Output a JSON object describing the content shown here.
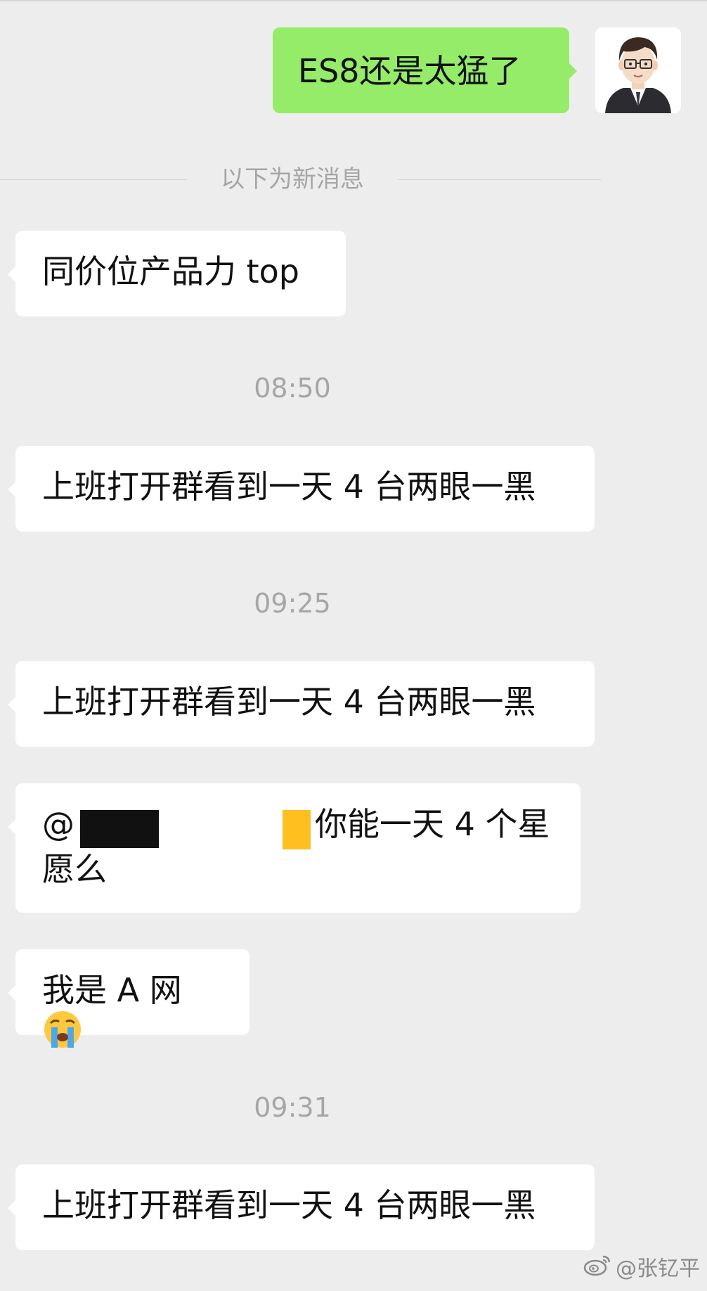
{
  "messages": {
    "outgoing_1": "ES8还是太猛了",
    "divider_label": "以下为新消息",
    "incoming_1": "同价位产品力 top",
    "time_1": "08:50",
    "incoming_2": "上班打开群看到一天 4 台两眼一黑",
    "time_2": "09:25",
    "incoming_3": "上班打开群看到一天 4 台两眼一黑",
    "incoming_4": {
      "at": "@",
      "text_line1": "你能一天 4 个星",
      "text_line2": "愿么"
    },
    "incoming_5": "我是 A 网",
    "time_3": "09:31",
    "incoming_6": "上班打开群看到一天 4 台两眼一黑"
  },
  "watermark": "@张钇平",
  "icons": {
    "avatar": "cartoon-man-with-glasses",
    "emoji": "loudly-crying-face",
    "watermark_logo": "weibo-logo"
  },
  "colors": {
    "background": "#ededed",
    "outgoing_bubble": "#95ec69",
    "incoming_bubble": "#ffffff",
    "timestamp_text": "#a6a6a6",
    "redaction_black": "#111111",
    "redaction_yellow": "#ffbf1f"
  }
}
